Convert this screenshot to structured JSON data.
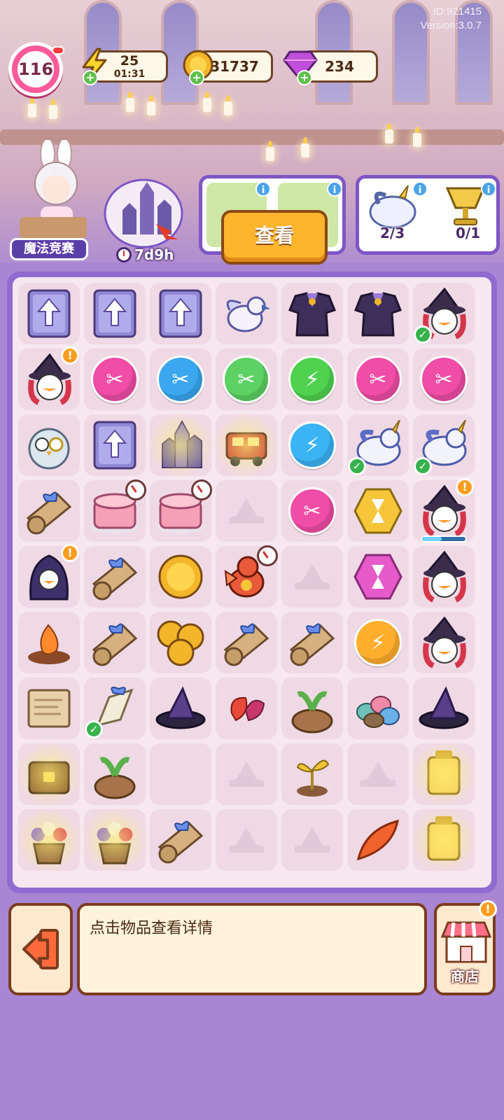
{
  "header": {
    "id_text": "ID:921415",
    "version_text": "Version:3.0.7",
    "level": "116",
    "energy": {
      "value": "25",
      "timer": "01:31",
      "icon": "lightning-icon"
    },
    "coins": {
      "value": "31737",
      "icon": "coin-icon"
    },
    "gems": {
      "value": "234",
      "icon": "gem-icon"
    }
  },
  "event": {
    "label": "魔法竞赛",
    "timer": "7d9h"
  },
  "orders": {
    "view_button": "查看",
    "card2_progress_1": "2/3",
    "card2_progress_2": "0/1"
  },
  "board": {
    "rows": [
      [
        "card",
        "card",
        "card",
        "bird",
        "robe",
        "robe",
        "witch-check"
      ],
      [
        "witch-alert",
        "scissors-pink",
        "scissors-blue",
        "scissors-green",
        "energy-green",
        "scissors-pink",
        "scissors-pink"
      ],
      [
        "owl",
        "card",
        "castle-glow",
        "train-glow",
        "energy-blue",
        "unicorn-check",
        "unicorn-check"
      ],
      [
        "scroll-bow",
        "cake-timer",
        "cake-timer",
        "empty",
        "scissors-pink",
        "hourglass-gold",
        "witch-alert-bar"
      ],
      [
        "hooded-alert",
        "scroll-bow",
        "coin",
        "dragon-timer",
        "empty",
        "hourglass-pink",
        "witch-snake"
      ],
      [
        "campfire",
        "scroll-bow",
        "coins",
        "scroll-bow",
        "scroll-bow",
        "energy-orange",
        "witch-snake"
      ],
      [
        "map",
        "scroll-open-check",
        "hat",
        "leaf",
        "mandrake",
        "stones",
        "hat"
      ],
      [
        "chest-glow",
        "mandrake2",
        "blank",
        "empty",
        "sprout",
        "empty",
        "lantern-glow"
      ],
      [
        "flowers-glow",
        "flowers-glow",
        "scroll-bow",
        "empty",
        "empty",
        "feather",
        "lantern-glow"
      ]
    ]
  },
  "footer": {
    "hint": "点击物品查看详情",
    "shop_label": "商店"
  }
}
